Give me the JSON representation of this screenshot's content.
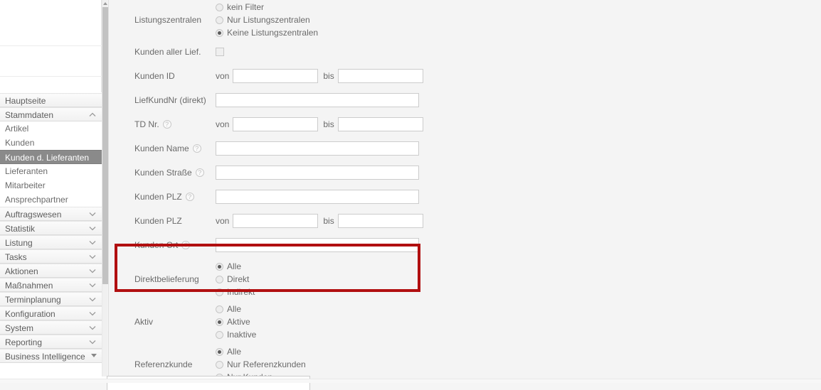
{
  "sidebar": {
    "items": [
      {
        "label": "Hauptseite",
        "type": "group",
        "chevron": "none",
        "selected": false
      },
      {
        "label": "Stammdaten",
        "type": "group",
        "chevron": "up",
        "selected": false
      },
      {
        "label": "Artikel",
        "type": "leaf",
        "chevron": "none",
        "selected": false
      },
      {
        "label": "Kunden",
        "type": "leaf",
        "chevron": "none",
        "selected": false
      },
      {
        "label": "Kunden d. Lieferanten",
        "type": "leaf",
        "chevron": "none",
        "selected": true
      },
      {
        "label": "Lieferanten",
        "type": "leaf",
        "chevron": "none",
        "selected": false
      },
      {
        "label": "Mitarbeiter",
        "type": "leaf",
        "chevron": "none",
        "selected": false
      },
      {
        "label": "Ansprechpartner",
        "type": "leaf",
        "chevron": "none",
        "selected": false
      },
      {
        "label": "Auftragswesen",
        "type": "group",
        "chevron": "down",
        "selected": false
      },
      {
        "label": "Statistik",
        "type": "group",
        "chevron": "down",
        "selected": false
      },
      {
        "label": "Listung",
        "type": "group",
        "chevron": "down",
        "selected": false
      },
      {
        "label": "Tasks",
        "type": "group",
        "chevron": "down",
        "selected": false
      },
      {
        "label": "Aktionen",
        "type": "group",
        "chevron": "down",
        "selected": false
      },
      {
        "label": "Maßnahmen",
        "type": "group",
        "chevron": "down",
        "selected": false
      },
      {
        "label": "Terminplanung",
        "type": "group",
        "chevron": "down",
        "selected": false
      },
      {
        "label": "Konfiguration",
        "type": "group",
        "chevron": "down",
        "selected": false
      },
      {
        "label": "System",
        "type": "group",
        "chevron": "down",
        "selected": false
      },
      {
        "label": "Reporting",
        "type": "group",
        "chevron": "down",
        "selected": false
      },
      {
        "label": "Business Intelligence",
        "type": "group",
        "chevron": "scroll-down",
        "selected": false
      }
    ]
  },
  "form": {
    "range_from_label": "von",
    "range_to_label": "bis",
    "listungszentralen": {
      "label": "Listungszentralen",
      "options": [
        {
          "text": "kein Filter",
          "selected": false
        },
        {
          "text": "Nur Listungszentralen",
          "selected": false
        },
        {
          "text": "Keine Listungszentralen",
          "selected": true
        }
      ]
    },
    "kunden_aller_lief": {
      "label": "Kunden aller Lief.",
      "checked": false
    },
    "kunden_id": {
      "label": "Kunden ID",
      "von": "",
      "bis": ""
    },
    "liefkundnr": {
      "label": "LiefKundNr (direkt)",
      "value": ""
    },
    "td_nr": {
      "label": "TD Nr.",
      "help": "?",
      "von": "",
      "bis": ""
    },
    "kunden_name": {
      "label": "Kunden Name",
      "help": "?",
      "value": ""
    },
    "kunden_strasse": {
      "label": "Kunden Straße",
      "help": "?",
      "value": ""
    },
    "kunden_plz_text": {
      "label": "Kunden PLZ",
      "help": "?",
      "value": ""
    },
    "kunden_plz_range": {
      "label": "Kunden PLZ",
      "von": "",
      "bis": ""
    },
    "kunden_ort": {
      "label": "Kunden Ort",
      "help": "?",
      "value": ""
    },
    "direktbelieferung": {
      "label": "Direktbelieferung",
      "options": [
        {
          "text": "Alle",
          "selected": true
        },
        {
          "text": "Direkt",
          "selected": false
        },
        {
          "text": "Indirekt",
          "selected": false
        }
      ]
    },
    "aktiv": {
      "label": "Aktiv",
      "options": [
        {
          "text": "Alle",
          "selected": false
        },
        {
          "text": "Aktive",
          "selected": true
        },
        {
          "text": "Inaktive",
          "selected": false
        }
      ]
    },
    "referenzkunde": {
      "label": "Referenzkunde",
      "options": [
        {
          "text": "Alle",
          "selected": true
        },
        {
          "text": "Nur Referenzkunden",
          "selected": false
        },
        {
          "text": "Nur Kunden",
          "selected": false
        }
      ]
    }
  },
  "annotation": {
    "highlight_color": "#b10f10",
    "highlight_target": "Direktbelieferung"
  }
}
